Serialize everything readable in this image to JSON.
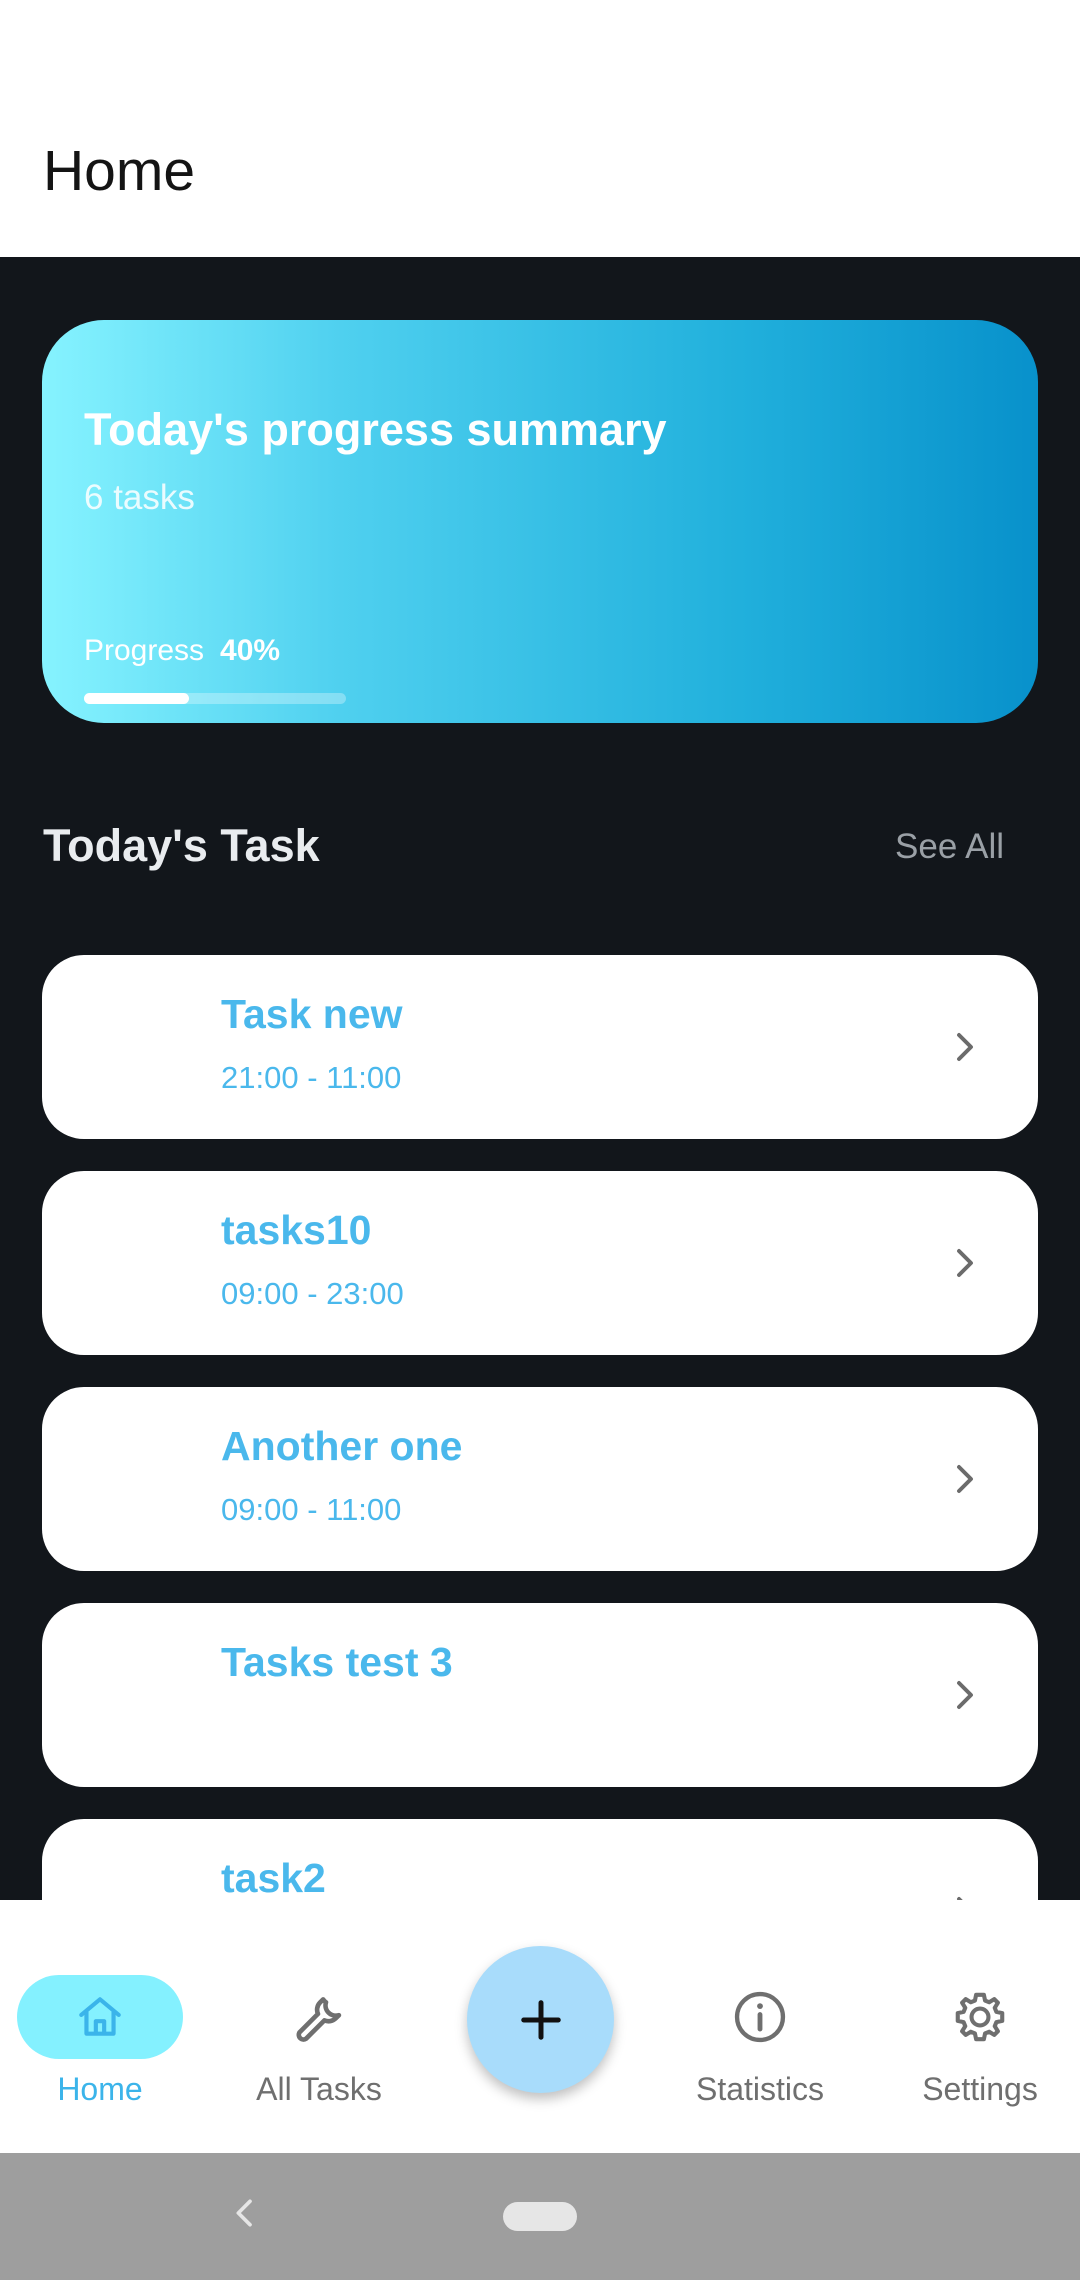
{
  "appbar": {
    "title": "Home"
  },
  "summary": {
    "title": "Today's progress summary",
    "count": "6 tasks",
    "progress_label": "Progress",
    "progress_text": "40%",
    "progress_value": 0.4
  },
  "section": {
    "title": "Today's Task",
    "see_all": "See All"
  },
  "tasks": [
    {
      "name": "Task new",
      "time": "21:00 - 11:00"
    },
    {
      "name": "tasks10",
      "time": "09:00 - 23:00"
    },
    {
      "name": "Another one",
      "time": "09:00 - 11:00"
    },
    {
      "name": "Tasks test 3",
      "time": ""
    },
    {
      "name": "task2",
      "time": ""
    }
  ],
  "nav": {
    "home": "Home",
    "all_tasks": "All Tasks",
    "statistics": "Statistics",
    "settings": "Settings"
  },
  "colors": {
    "accent": "#4ab8ec",
    "background": "#12161b",
    "active_nav": "#84f1ff",
    "fab": "#a8dcfb"
  }
}
